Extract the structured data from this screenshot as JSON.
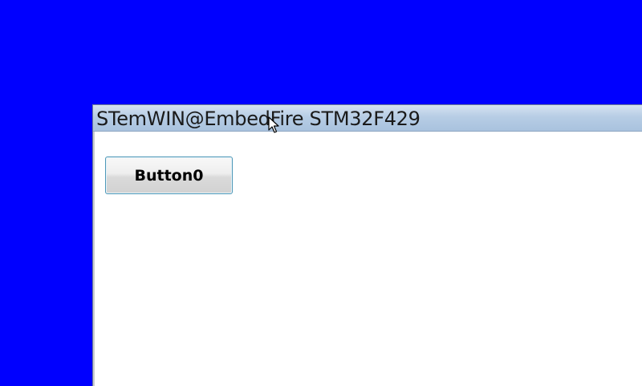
{
  "desktop": {
    "background_color": "#0000ff"
  },
  "window": {
    "title": "STemWIN@EmbedFire STM32F429",
    "titlebar_color": "#b7cde5",
    "client_color": "#ffffff"
  },
  "buttons": [
    {
      "label": "Button0"
    }
  ],
  "cursor": {
    "icon": "mouse-pointer-icon"
  }
}
